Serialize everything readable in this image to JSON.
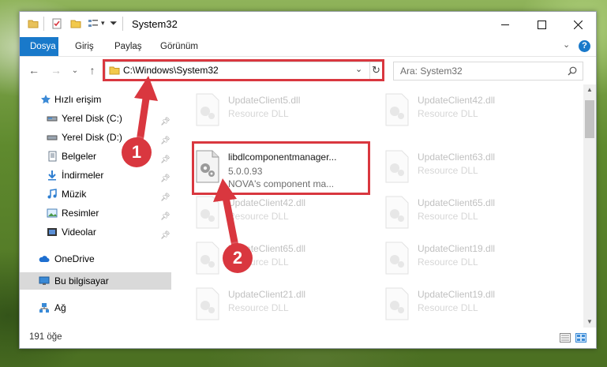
{
  "window": {
    "title": "System32",
    "minimize_icon": "minimize-icon",
    "maximize_icon": "maximize-icon",
    "close_icon": "close-icon"
  },
  "ribbon": {
    "tabs": [
      {
        "label": "Dosya",
        "active": true
      },
      {
        "label": "Giriş"
      },
      {
        "label": "Paylaş"
      },
      {
        "label": "Görünüm"
      }
    ]
  },
  "navigation": {
    "address": "C:\\Windows\\System32",
    "search_placeholder": "Ara: System32"
  },
  "sidebar": {
    "items": [
      {
        "label": "Hızlı erişim",
        "icon": "star-icon"
      },
      {
        "label": "Yerel Disk (C:)",
        "icon": "drive-icon",
        "pinned": true
      },
      {
        "label": "Yerel Disk (D:)",
        "icon": "drive-icon",
        "pinned": true
      },
      {
        "label": "Belgeler",
        "icon": "documents-icon",
        "pinned": true
      },
      {
        "label": "İndirmeler",
        "icon": "download-icon",
        "pinned": true
      },
      {
        "label": "Müzik",
        "icon": "music-icon",
        "pinned": true
      },
      {
        "label": "Resimler",
        "icon": "pictures-icon",
        "pinned": true
      },
      {
        "label": "Videolar",
        "icon": "video-icon",
        "pinned": true
      },
      {
        "label": "OneDrive",
        "icon": "cloud-icon"
      },
      {
        "label": "Bu bilgisayar",
        "icon": "computer-icon",
        "selected": true
      },
      {
        "label": "Ağ",
        "icon": "network-icon"
      }
    ]
  },
  "files": {
    "left": [
      {
        "name": "UpdateClient5.dll",
        "type": "Resource DLL"
      },
      {
        "name": "libdlcomponentmanager...",
        "version": "5.0.0.93",
        "description": "NOVA's component ma..."
      },
      {
        "name": "UpdateClient42.dll",
        "type": "Resource DLL"
      },
      {
        "name": "UpdateClient65.dll",
        "type": "Resource DLL"
      },
      {
        "name": "UpdateClient21.dll",
        "type": "Resource DLL"
      }
    ],
    "right": [
      {
        "name": "UpdateClient42.dll",
        "type": "Resource DLL"
      },
      {
        "name": "UpdateClient63.dll",
        "type": "Resource DLL"
      },
      {
        "name": "UpdateClient65.dll",
        "type": "Resource DLL"
      },
      {
        "name": "UpdateClient19.dll",
        "type": "Resource DLL"
      },
      {
        "name": "UpdateClient19.dll",
        "type": "Resource DLL"
      }
    ]
  },
  "status": {
    "item_count": "191 öğe"
  },
  "annotations": {
    "step1": "1",
    "step2": "2",
    "color": "#d9373f"
  }
}
